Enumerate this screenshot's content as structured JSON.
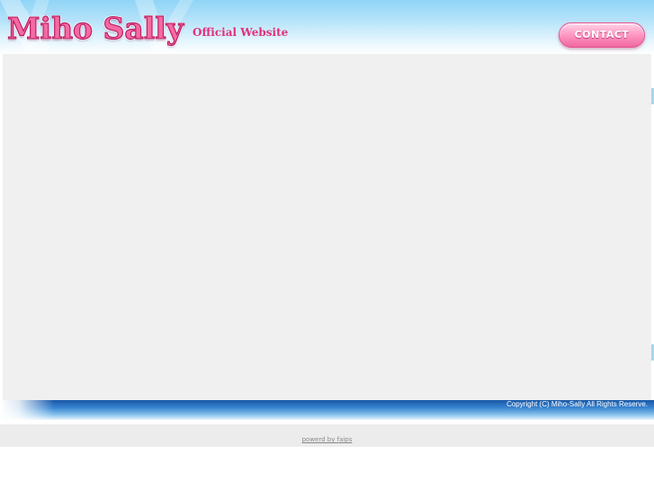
{
  "header": {
    "logo_text": "Miho Sally",
    "tagline": "Official Website",
    "contact_label": "CONTACT"
  },
  "footer": {
    "copyright": "Copyright (C) Miho-Sally All Rights Reserve.",
    "powered_by": "powerd by faips"
  },
  "colors": {
    "logo_pink": "#f56aa2",
    "tagline_pink": "#e0307a",
    "footer_blue": "#1857a6",
    "content_gray": "#f0f0f0"
  }
}
